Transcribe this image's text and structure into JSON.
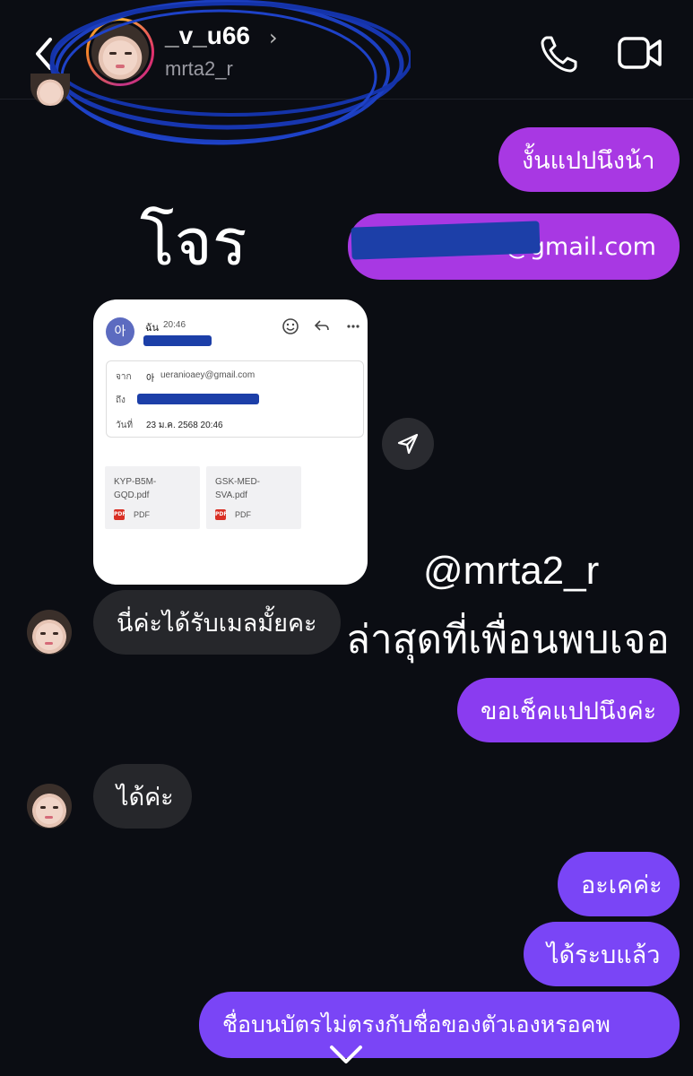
{
  "header": {
    "username": "_v_u66",
    "handle": "mrta2_r",
    "chevron": "›"
  },
  "icons": [
    "back-chevron-icon",
    "phone-icon",
    "video-camera-icon",
    "send-icon",
    "chevron-down-icon"
  ],
  "messages": [
    {
      "side": "right",
      "text": "งั้นแปปนึงน้า"
    },
    {
      "side": "right",
      "text": "@gmail.com"
    },
    {
      "side": "left",
      "text": "นี่ค่ะได้รับเมลมั้ยคะ"
    },
    {
      "side": "right",
      "text": "ขอเช็คแปปนึงค่ะ"
    },
    {
      "side": "left",
      "text": "ได้ค่ะ"
    },
    {
      "side": "right",
      "text": "อะเคค่ะ"
    },
    {
      "side": "right",
      "text": "ได้ระบแล้ว"
    },
    {
      "side": "right",
      "text": "ชื่อบนบัตรไม่ตรงกับชื่อของตัวเองหรอคพ"
    }
  ],
  "email_card": {
    "avatar_letter": "아",
    "sender_label": "ฉัน",
    "time": "20:46",
    "from_label": "จาก",
    "from_name": "아",
    "from_email": "ueranioaey@gmail.com",
    "to_label": "ถึง",
    "date_label": "วันที่",
    "date_value": "23 ม.ค. 2568 20:46",
    "attachments": [
      {
        "name": "KYP-B5M-GQD.pdf",
        "line1": "KYP-B5M-",
        "line2": "GQD.pdf",
        "type": "PDF"
      },
      {
        "name": "GSK-MED-SVA.pdf",
        "line1": "GSK-MED-",
        "line2": "SVA.pdf",
        "type": "PDF"
      }
    ],
    "pdf_badge": "PDF"
  },
  "overlays": {
    "thief_label": "โจร",
    "handle_caption": "@mrta2_r",
    "caption": "ล่าสุดที่เพื่อนพบเจอ"
  },
  "colors": {
    "background": "#0b0d13",
    "bubble_incoming": "#26272b",
    "bubble_purple_top": "#a838e3",
    "bubble_purple_bottom": "#7a45f6",
    "redaction": "#1c3fa8"
  }
}
